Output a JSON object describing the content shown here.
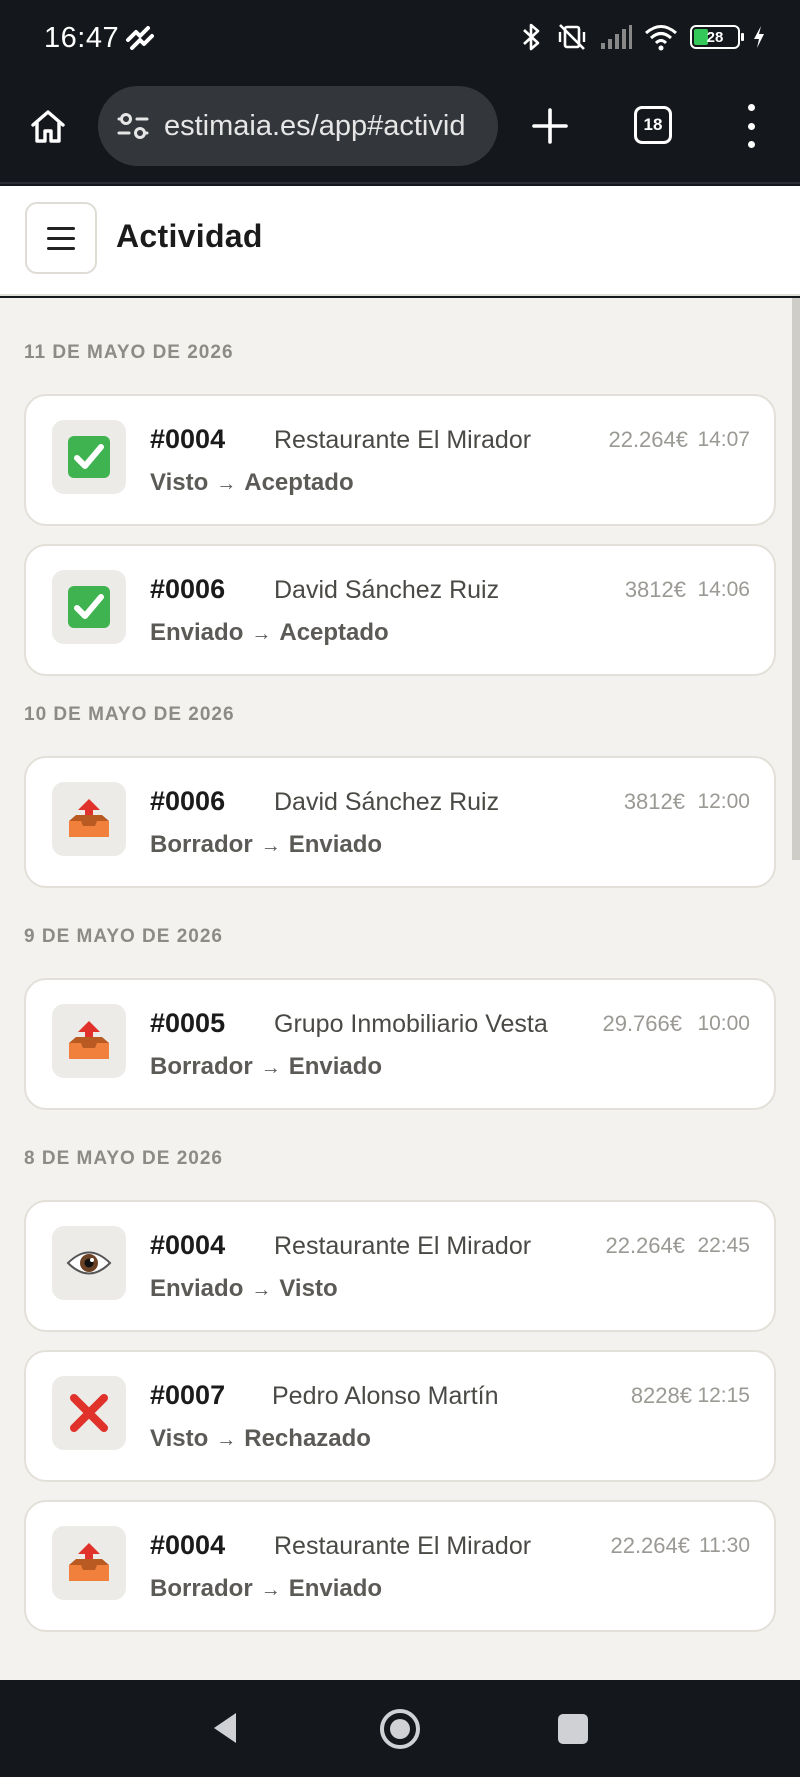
{
  "status_bar": {
    "time": "16:47",
    "battery_level": "28"
  },
  "browser": {
    "url": "estimaia.es/app#activid",
    "tab_count": "18"
  },
  "app": {
    "title": "Actividad"
  },
  "days": [
    {
      "label": "11 DE MAYO DE 2026",
      "items": [
        {
          "ref": "#0004",
          "client": "Restaurante El Mirador",
          "amount": "22.264€",
          "time": "14:07",
          "from": "Visto",
          "to": "Aceptado",
          "icon": "check-mark-icon"
        },
        {
          "ref": "#0006",
          "client": "David Sánchez Ruiz",
          "amount": "3812€",
          "time": "14:06",
          "from": "Enviado",
          "to": "Aceptado",
          "icon": "check-mark-icon"
        }
      ]
    },
    {
      "label": "10 DE MAYO DE 2026",
      "items": [
        {
          "ref": "#0006",
          "client": "David Sánchez Ruiz",
          "amount": "3812€",
          "time": "12:00",
          "from": "Borrador",
          "to": "Enviado",
          "icon": "outbox-tray-icon"
        }
      ]
    },
    {
      "label": "9 DE MAYO DE 2026",
      "items": [
        {
          "ref": "#0005",
          "client": "Grupo Inmobiliario Vesta",
          "amount": "29.766€",
          "time": "10:00",
          "from": "Borrador",
          "to": "Enviado",
          "icon": "outbox-tray-icon"
        }
      ]
    },
    {
      "label": "8 DE MAYO DE 2026",
      "items": [
        {
          "ref": "#0004",
          "client": "Restaurante El Mirador",
          "amount": "22.264€",
          "time": "22:45",
          "from": "Enviado",
          "to": "Visto",
          "icon": "eye-icon"
        },
        {
          "ref": "#0007",
          "client": "Pedro Alonso Martín",
          "amount": "8228€",
          "time": "12:15",
          "from": "Visto",
          "to": "Rechazado",
          "icon": "cross-mark-icon"
        },
        {
          "ref": "#0004",
          "client": "Restaurante El Mirador",
          "amount": "22.264€",
          "time": "11:30",
          "from": "Borrador",
          "to": "Enviado",
          "icon": "outbox-tray-icon"
        }
      ]
    }
  ],
  "arrow": "→",
  "colors": {
    "accepted_green": "#3fb34f",
    "rejected_red": "#e0312b",
    "outbox_orange": "#f0803c",
    "page_bg": "#f3f2ee"
  }
}
